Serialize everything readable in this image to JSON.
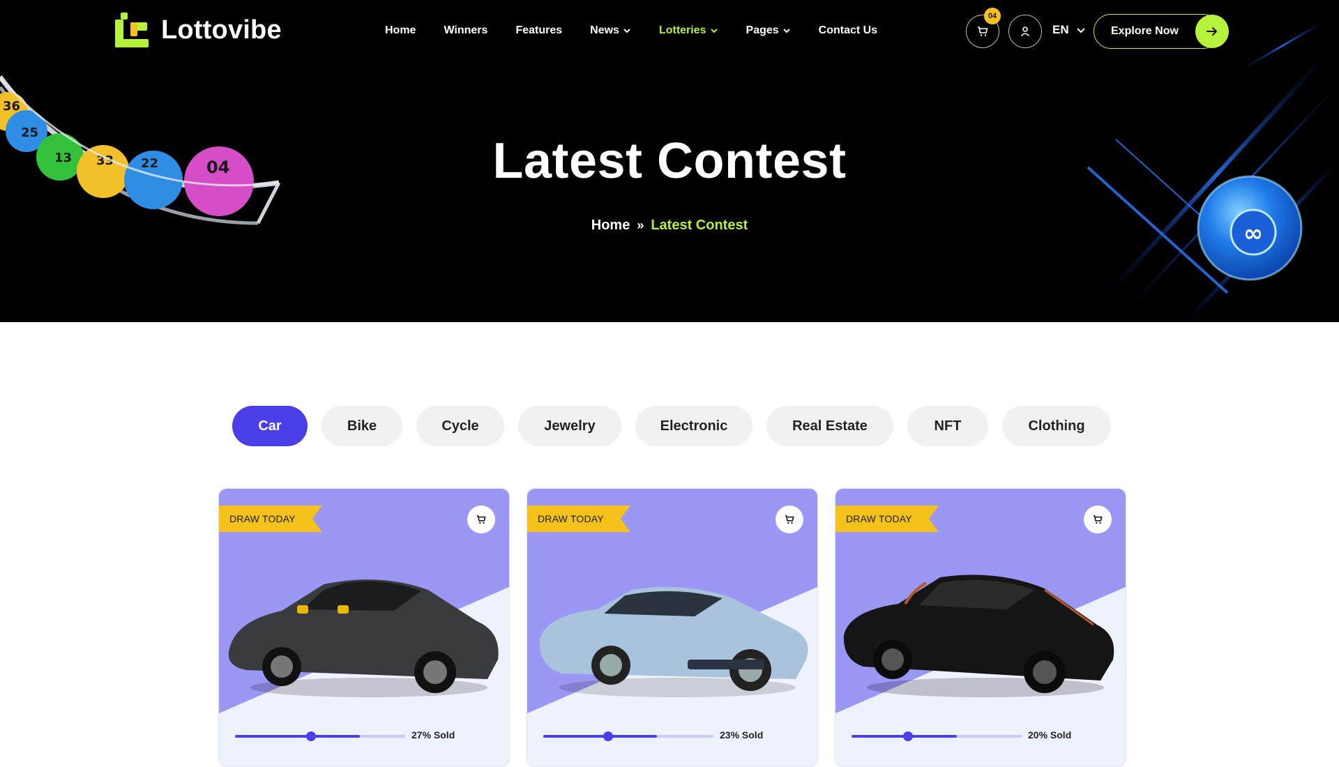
{
  "brand": {
    "name": "Lottovibe",
    "accent": "#b6f23b",
    "primary": "#4a3fe8"
  },
  "nav": {
    "items": [
      {
        "label": "Home",
        "dropdown": false,
        "active": false
      },
      {
        "label": "Winners",
        "dropdown": false,
        "active": false
      },
      {
        "label": "Features",
        "dropdown": false,
        "active": false
      },
      {
        "label": "News",
        "dropdown": true,
        "active": false
      },
      {
        "label": "Lotteries",
        "dropdown": true,
        "active": true
      },
      {
        "label": "Pages",
        "dropdown": true,
        "active": false
      },
      {
        "label": "Contact Us",
        "dropdown": false,
        "active": false
      }
    ],
    "cart_count": "04",
    "language": "EN",
    "cta_label": "Explore Now"
  },
  "hero": {
    "title": "Latest Contest",
    "breadcrumb": {
      "home": "Home",
      "current": "Latest Contest"
    },
    "ball_numbers": [
      "36",
      "25",
      "13",
      "33",
      "22",
      "04"
    ]
  },
  "categories": {
    "selected": "Car",
    "items": [
      "Car",
      "Bike",
      "Cycle",
      "Jewelry",
      "Electronic",
      "Real Estate",
      "NFT",
      "Clothing"
    ]
  },
  "contests": [
    {
      "badge": "DRAW TODAY",
      "sold_percent": 27,
      "sold_label": "27% Sold",
      "car_color": "#3a3b3e"
    },
    {
      "badge": "DRAW TODAY",
      "sold_percent": 23,
      "sold_label": "23% Sold",
      "car_color": "#aac3dc"
    },
    {
      "badge": "DRAW TODAY",
      "sold_percent": 20,
      "sold_label": "20% Sold",
      "car_color": "#151515"
    }
  ]
}
